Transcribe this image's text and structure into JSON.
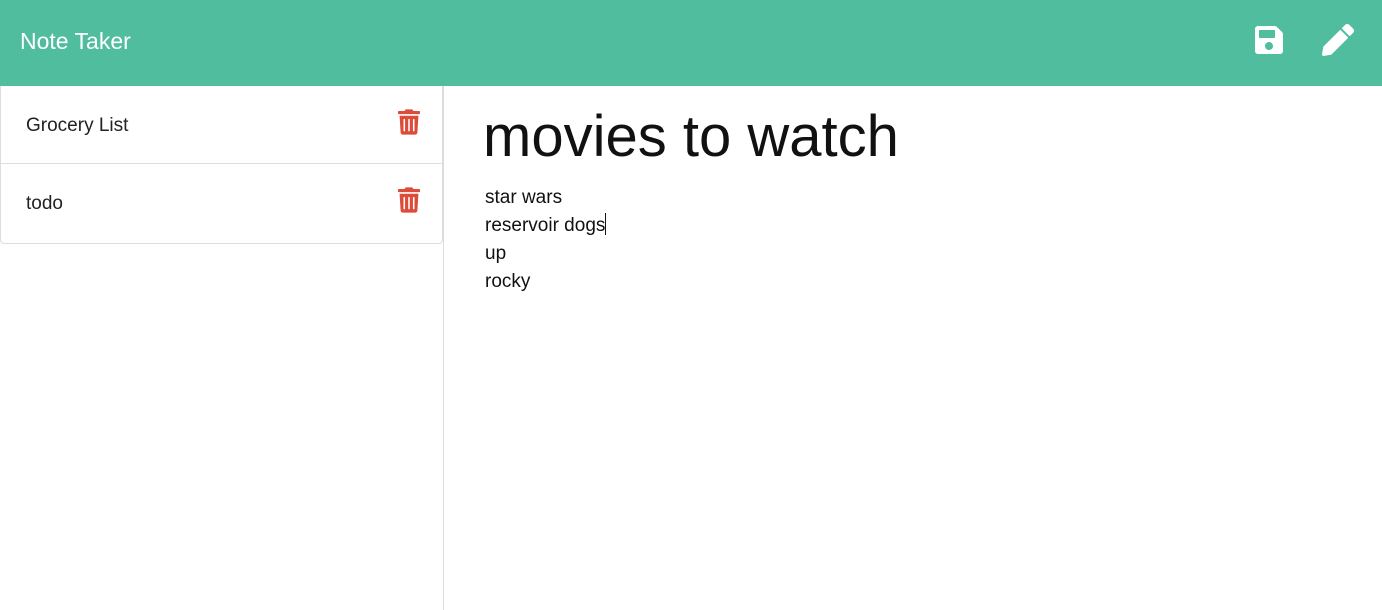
{
  "app": {
    "brand": "Note Taker",
    "accent_color": "#50bd9e",
    "delete_color": "#dd4b39"
  },
  "toolbar": {
    "save_icon": "save-icon",
    "edit_icon": "pencil-icon"
  },
  "sidebar": {
    "notes": [
      {
        "title": "Grocery List",
        "delete_icon": "trash-icon"
      },
      {
        "title": "todo",
        "delete_icon": "trash-icon"
      }
    ]
  },
  "editor": {
    "title": "movies to watch",
    "body_lines": [
      "star wars",
      "reservoir dogs",
      "up",
      "rocky"
    ],
    "caret_line": 1
  }
}
